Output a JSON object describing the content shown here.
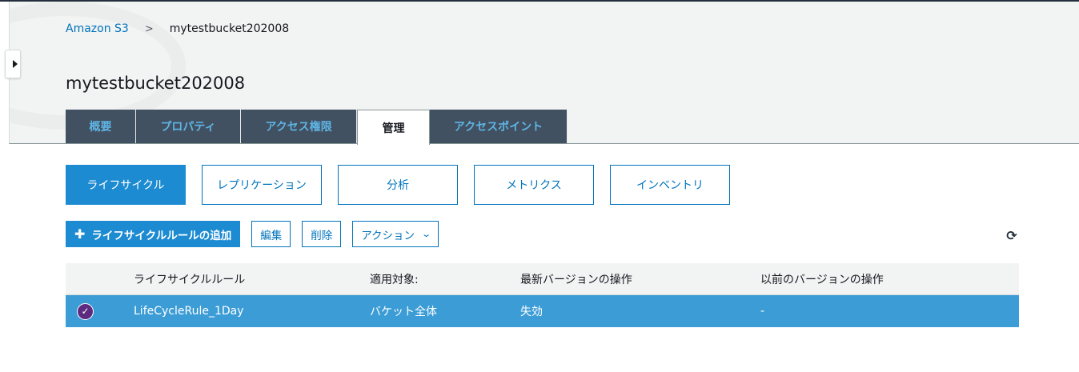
{
  "breadcrumb": {
    "root": "Amazon S3",
    "separator": ">",
    "current": "mytestbucket202008"
  },
  "page_title": "mytestbucket202008",
  "tabs": [
    {
      "label": "概要"
    },
    {
      "label": "プロパティ"
    },
    {
      "label": "アクセス権限"
    },
    {
      "label": "管理",
      "active": true
    },
    {
      "label": "アクセスポイント"
    }
  ],
  "subtabs": [
    {
      "label": "ライフサイクル",
      "active": true
    },
    {
      "label": "レプリケーション"
    },
    {
      "label": "分析"
    },
    {
      "label": "メトリクス"
    },
    {
      "label": "インベントリ"
    }
  ],
  "toolbar": {
    "add_rule_label": "ライフサイクルルールの追加",
    "edit_label": "編集",
    "delete_label": "削除",
    "actions_label": "アクション"
  },
  "icons": {
    "sidebar_toggle": "caret-right-icon",
    "add": "plus-icon",
    "actions": "chevron-down-icon",
    "refresh": "refresh-icon",
    "row_selected": "check-circle-icon"
  },
  "table": {
    "columns": [
      "ライフサイクルルール",
      "適用対象:",
      "最新バージョンの操作",
      "以前のバージョンの操作"
    ],
    "rows": [
      {
        "selected": true,
        "name": "LifeCycleRule_1Day",
        "scope": "バケット全体",
        "current_action": "失効",
        "previous_action": "-"
      }
    ]
  },
  "colors": {
    "link": "#0073bb",
    "tab_bg": "#415161",
    "tab_text": "#5fb4e5",
    "primary_button": "#1d8bd1",
    "selected_row": "#3c9cd6",
    "check_badge": "#5d2a80"
  }
}
